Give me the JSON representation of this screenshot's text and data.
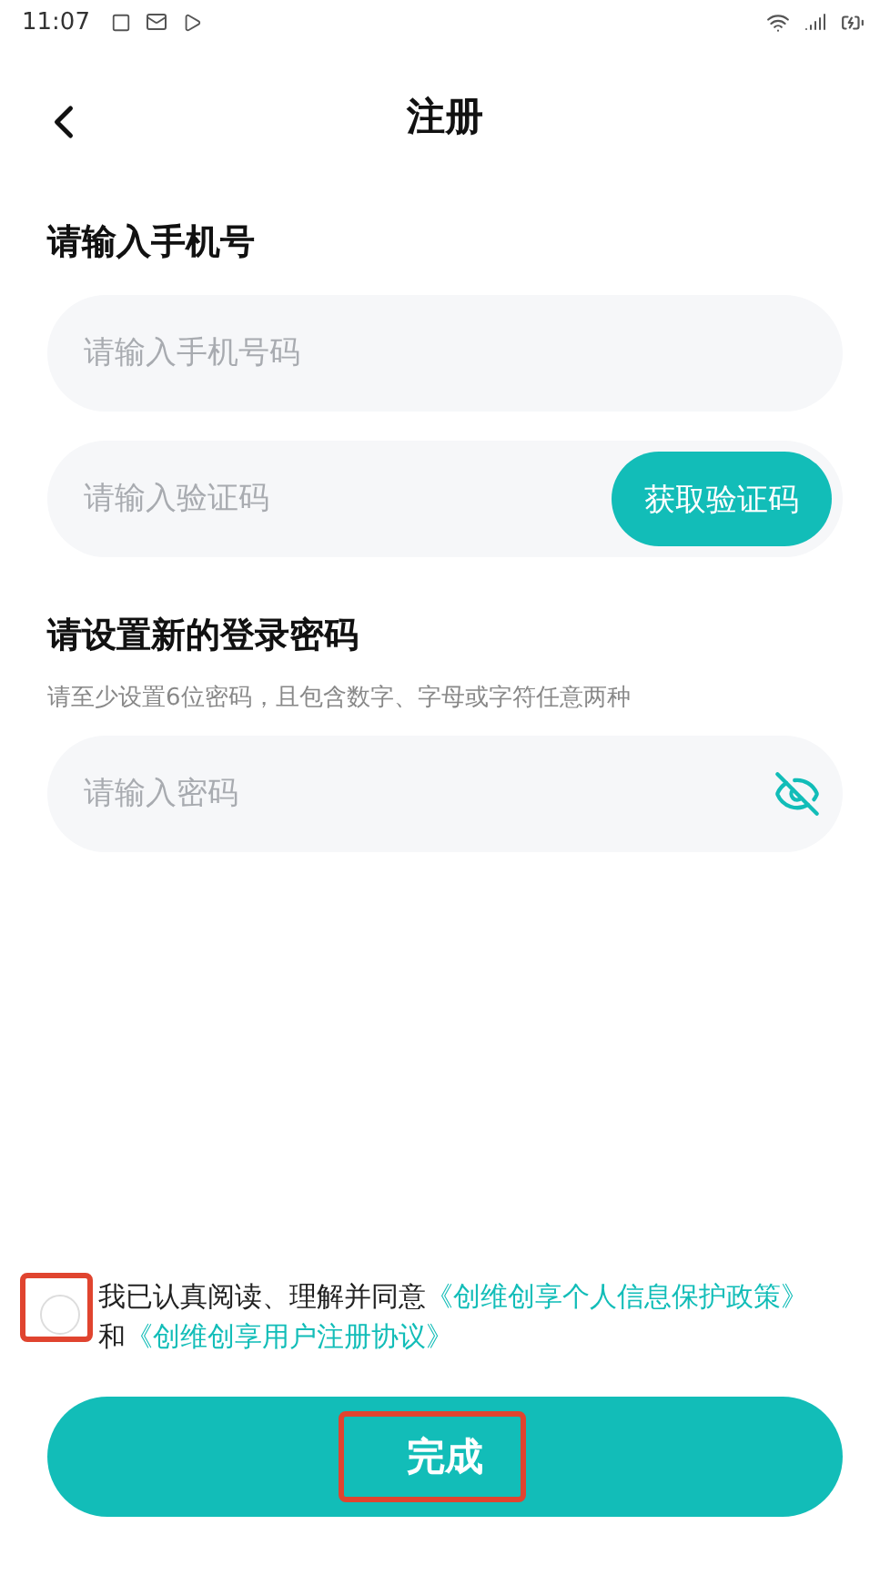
{
  "status_bar": {
    "time": "11:07"
  },
  "header": {
    "title": "注册"
  },
  "phone_section": {
    "title": "请输入手机号",
    "phone_field": {
      "placeholder": "请输入手机号码"
    },
    "code_field": {
      "placeholder": "请输入验证码"
    },
    "code_button": "获取验证码"
  },
  "password_section": {
    "title": "请设置新的登录密码",
    "hint": "请至少设置6位密码，且包含数字、字母或字符任意两种",
    "password_field": {
      "placeholder": "请输入密码",
      "visible": false
    }
  },
  "agreement": {
    "checked": false,
    "text": "我已认真阅读、理解并同意",
    "links": [
      "《创维创享个人信息保护政策》",
      "《创维创享用户注册协议》"
    ],
    "joiner": "和"
  },
  "submit_button": "完成"
}
